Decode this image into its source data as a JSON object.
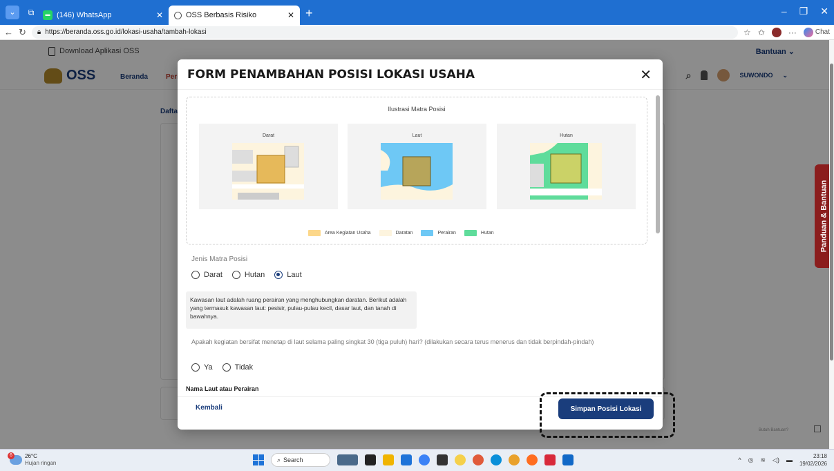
{
  "browser": {
    "tabs": [
      {
        "label": "(146) WhatsApp",
        "active": false
      },
      {
        "label": "OSS Berbasis Risiko",
        "active": true
      }
    ],
    "url": "https://beranda.oss.go.id/lokasi-usaha/tambah-lokasi",
    "chat_label": "Chat"
  },
  "page": {
    "download_app": "Download Aplikasi OSS",
    "bantuan": "Bantuan",
    "logo_text": "OSS",
    "nav_beranda": "Beranda",
    "nav_partial": "Peri",
    "user_name": "SUWONDO",
    "dafta_partial": "Dafta",
    "side_tab": "Panduan & Bantuan",
    "butuh_bantuan": "Butuh Bantuan?"
  },
  "modal": {
    "title": "FORM PENAMBAHAN POSISI LOKASI USAHA",
    "illustration_title": "Ilustrasi Matra Posisi",
    "panels": [
      "Darat",
      "Laut",
      "Hutan"
    ],
    "legend": [
      {
        "label": "Area Kegiatan Usaha",
        "color": "#fcd78a"
      },
      {
        "label": "Daratan",
        "color": "#fdf4de"
      },
      {
        "label": "Perairan",
        "color": "#6ec8f5"
      },
      {
        "label": "Hutan",
        "color": "#5fdc9b"
      }
    ],
    "jenis_label": "Jenis Matra Posisi",
    "jenis_options": [
      "Darat",
      "Hutan",
      "Laut"
    ],
    "jenis_selected": "Laut",
    "info_text": "Kawasan laut adalah ruang perairan yang menghubungkan daratan. Berikut adalah yang termasuk kawasan laut: pesisir, pulau-pulau kecil, dasar laut, dan tanah di bawahnya.",
    "question": "Apakah kegiatan bersifat menetap di laut selama paling singkat 30 (tiga puluh) hari? (dilakukan secara terus menerus dan tidak berpindah-pindah)",
    "yes_no": [
      "Ya",
      "Tidak"
    ],
    "nama_laut_label": "Nama Laut atau Perairan",
    "back_button": "Kembali",
    "save_button": "Simpan Posisi Lokasi"
  },
  "taskbar": {
    "temp": "26°C",
    "weather": "Hujan ringan",
    "weather_badge": "6",
    "search": "Search",
    "time": "23:18",
    "date": "19/02/2026"
  }
}
